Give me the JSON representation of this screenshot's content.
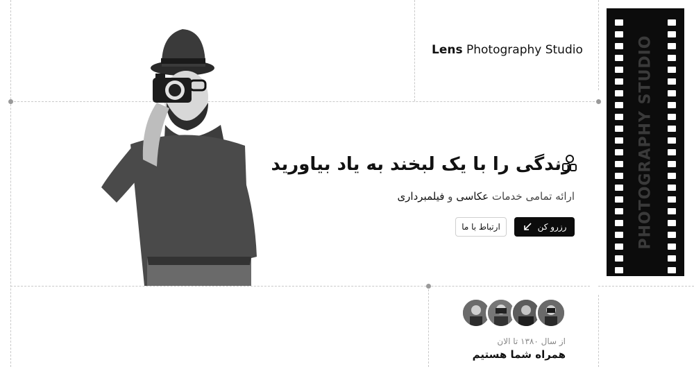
{
  "brand": {
    "bold": "Lens",
    "rest": " Photography Studio"
  },
  "filmstrip": {
    "text": "PHOTOGRAPHY STUDIO"
  },
  "hero": {
    "headline": "زندگی را با یک لبخند به یاد بیاورید",
    "subtitle_prefix": "ارائه تمامی خدمات ",
    "subtitle_em1": "عکاسی",
    "subtitle_mid": " و ",
    "subtitle_em2": "فیلمبرداری",
    "icon": "people-icon"
  },
  "buttons": {
    "book_label": "رزرو کن",
    "book_icon": "arrow-down-left-icon",
    "contact_label": "ارتباط با ما"
  },
  "team": {
    "since": "از سال ۱۳۸۰ تا الان",
    "together": "همراه شما هستیم",
    "avatars": [
      "avatar-1",
      "avatar-2",
      "avatar-3",
      "avatar-4"
    ]
  }
}
